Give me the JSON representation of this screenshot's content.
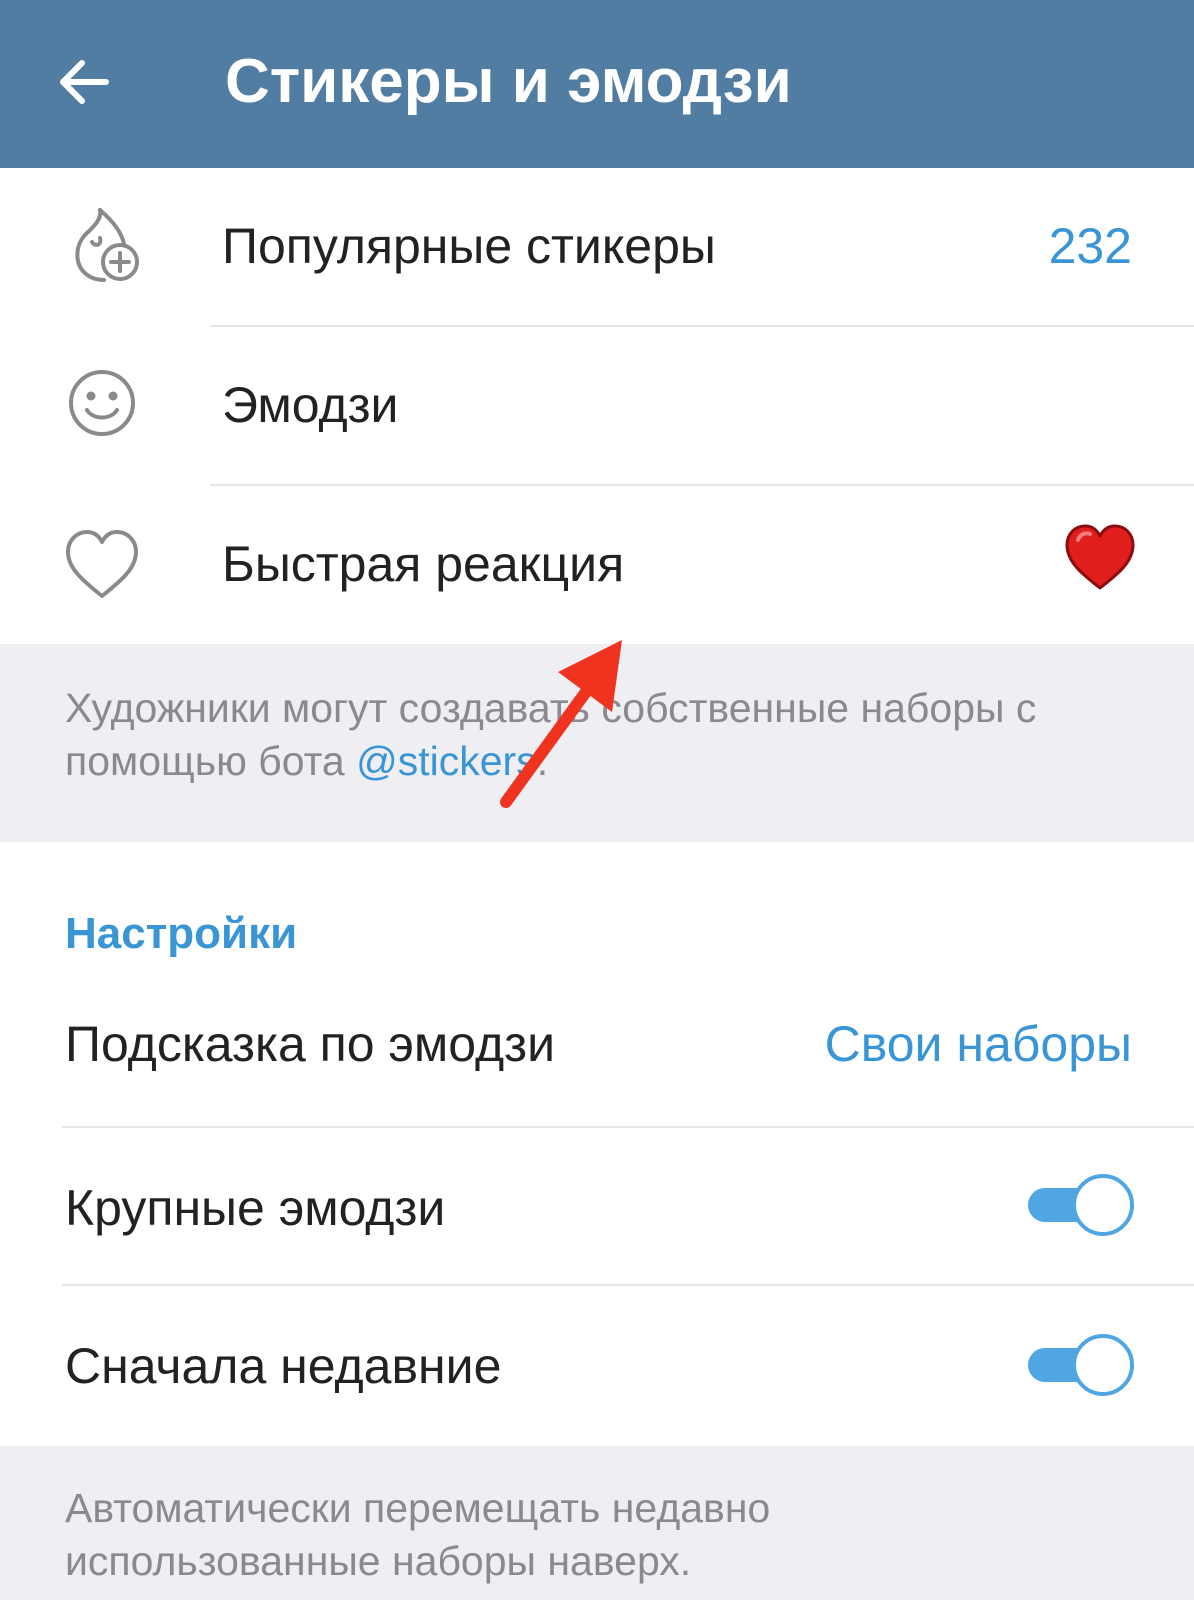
{
  "appbar": {
    "title": "Стикеры и эмодзи",
    "back_icon": "arrow-left-icon",
    "background": "#527da3"
  },
  "main_list": {
    "items": [
      {
        "icon": "fire-plus-icon",
        "label": "Популярные стикеры",
        "value": "232"
      },
      {
        "icon": "smile-icon",
        "label": "Эмодзи",
        "value": ""
      },
      {
        "icon": "heart-outline-icon",
        "label": "Быстрая реакция",
        "value_icon": "red-heart-emoji"
      }
    ]
  },
  "artists_hint": {
    "text_before": "Художники могут создавать собственные наборы с помощью бота ",
    "link": "@stickers",
    "text_after": "."
  },
  "settings": {
    "header": "Настройки",
    "emoji_suggestion": {
      "label": "Подсказка по эмодзи",
      "value": "Свои наборы"
    },
    "large_emoji": {
      "label": "Крупные эмодзи",
      "toggle_on": true
    },
    "recent_first": {
      "label": "Сначала недавние",
      "toggle_on": true
    }
  },
  "recent_hint": {
    "text": "Автоматически перемещать недавно использованные наборы наверх."
  },
  "annotation": {
    "icon": "red-arrow-annotation",
    "color": "#f0331f"
  },
  "colors": {
    "accent": "#3a95d5",
    "toggle": "#4fa6e2",
    "background": "#efeff3"
  }
}
